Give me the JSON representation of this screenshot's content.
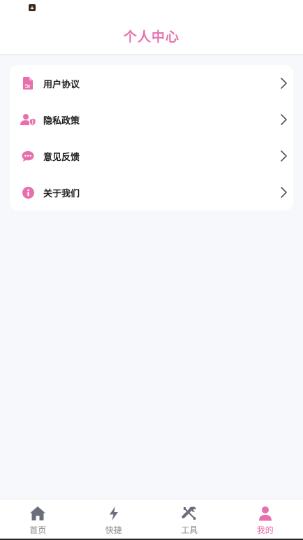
{
  "header": {
    "title": "个人中心",
    "status_icon": "app-notification-icon"
  },
  "menu": {
    "items": [
      {
        "label": "用户协议",
        "icon": "document-icon"
      },
      {
        "label": "隐私政策",
        "icon": "user-shield-icon"
      },
      {
        "label": "意见反馈",
        "icon": "chat-bubble-icon"
      },
      {
        "label": "关于我们",
        "icon": "info-icon"
      }
    ]
  },
  "bottom_nav": {
    "items": [
      {
        "label": "首页",
        "icon": "home-icon",
        "active": false
      },
      {
        "label": "快捷",
        "icon": "bolt-icon",
        "active": false
      },
      {
        "label": "工具",
        "icon": "tools-icon",
        "active": false
      },
      {
        "label": "我的",
        "icon": "user-icon",
        "active": true
      }
    ]
  },
  "colors": {
    "accent": "#e86fae",
    "background": "#f7f8fb",
    "nav_inactive": "#8a8a8a",
    "nav_icon_inactive": "#6b6f7b"
  }
}
